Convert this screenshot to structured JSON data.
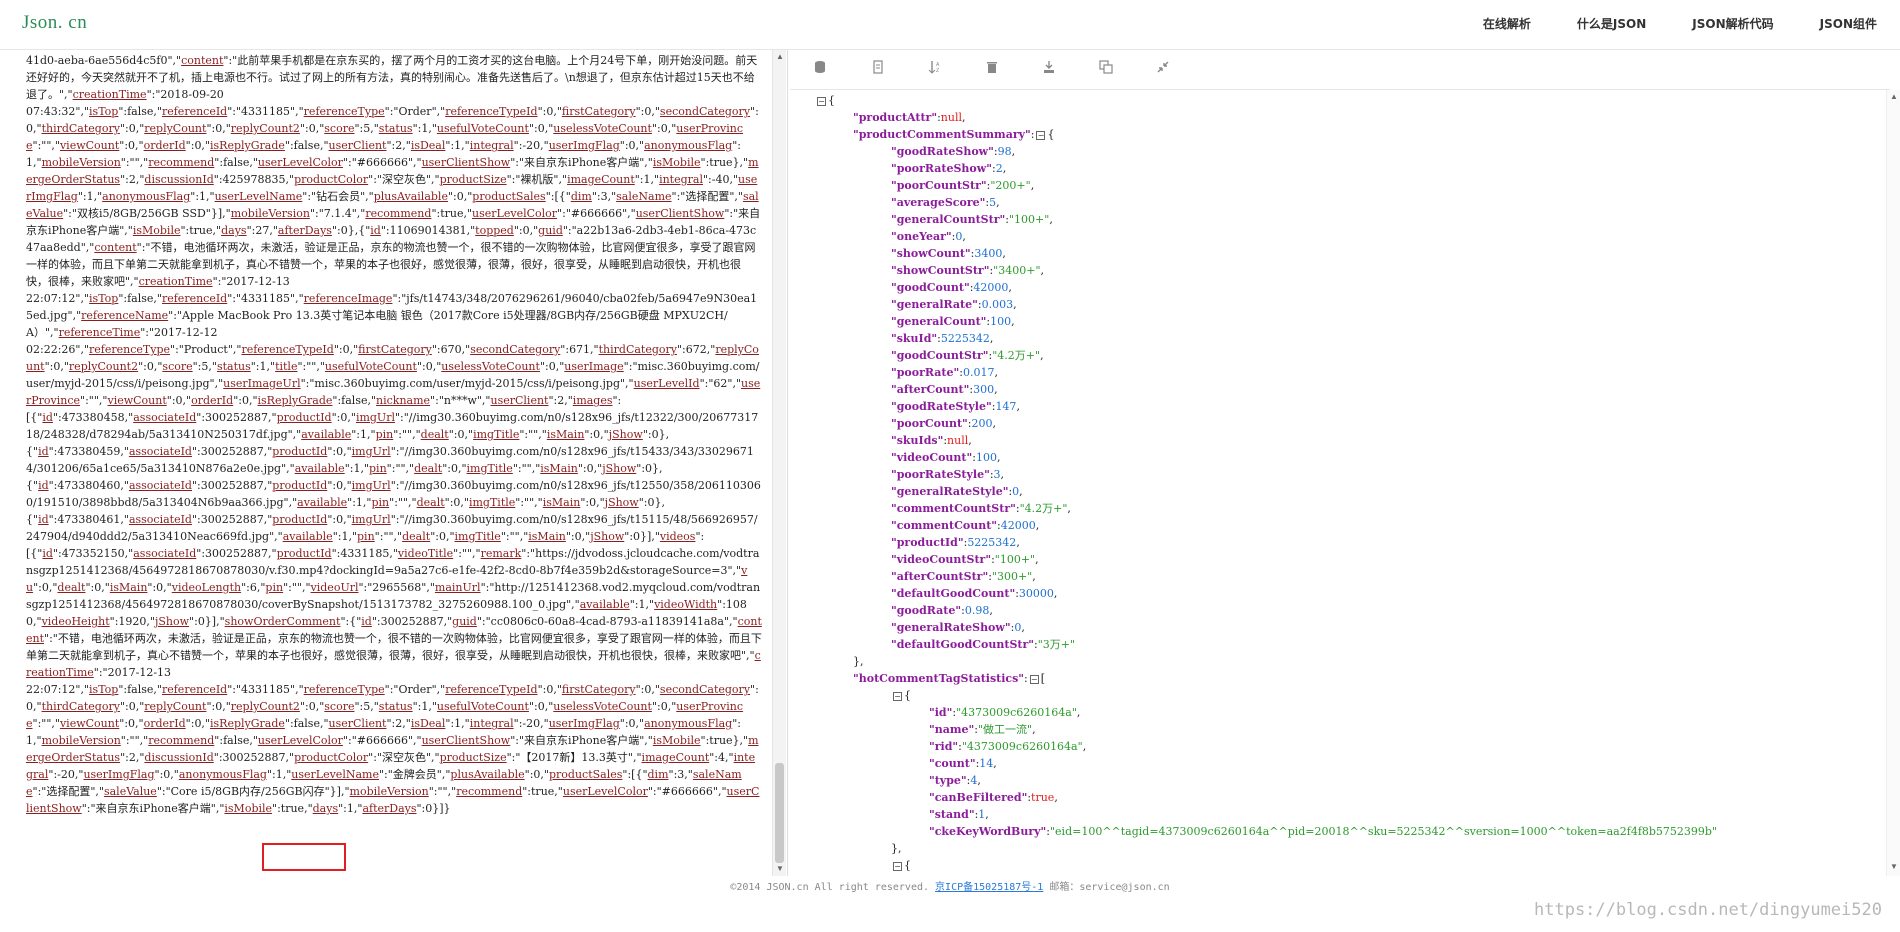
{
  "header": {
    "logo": "Json. cn",
    "nav": [
      "在线解析",
      "什么是JSON",
      "JSON解析代码",
      "JSON组件"
    ]
  },
  "left_text": [
    "41d0-aeba-6ae556d4c5f0\",\"content\":\"此前苹果手机都是在京东买的，摆了两个月的工资才买的这台电脑。上个月24号下单，刚开始没问题。前天还好好的，今天突然就开不了机，插上电源也不行。试过了网上的所有方法，真的特别闹心。准备先送售后了。\\n想退了，但京东估计超过15天也不给退了。\",\"creationTime\":\"2018-09-20",
    "07:43:32\",\"isTop\":false,\"referenceId\":\"4331185\",\"referenceType\":\"Order\",\"referenceTypeId\":0,\"firstCategory\":0,\"secondCategory\":0,\"thirdCategory\":0,\"replyCount\":0,\"replyCount2\":0,\"score\":5,\"status\":1,\"usefulVoteCount\":0,\"uselessVoteCount\":0,\"userProvince\":\"\",\"viewCount\":0,\"orderId\":0,\"isReplyGrade\":false,\"userClient\":2,\"isDeal\":1,\"integral\":-20,\"userImgFlag\":0,\"anonymousFlag\":1,\"mobileVersion\":\"\",\"recommend\":false,\"userLevelColor\":\"#666666\",\"userClientShow\":\"来自京东iPhone客户端\",\"isMobile\":true},\"mergeOrderStatus\":2,\"discussionId\":425978835,\"productColor\":\"深空灰色\",\"productSize\":\"裸机版\",\"imageCount\":1,\"integral\":-40,\"userImgFlag\":1,\"anonymousFlag\":1,\"userLevelName\":\"钻石会员\",\"plusAvailable\":0,\"productSales\":[{\"dim\":3,\"saleName\":\"选择配置\",\"saleValue\":\"双核i5/8GB/256GB SSD\"}],\"mobileVersion\":\"7.1.4\",\"recommend\":true,\"userLevelColor\":\"#666666\",\"userClientShow\":\"来自京东iPhone客户端\",\"isMobile\":true,\"days\":27,\"afterDays\":0},{\"id\":11069014381,\"topped\":0,\"guid\":\"a22b13a6-2db3-4eb1-86ca-473c47aa8edd\",\"content\":\"不错，电池循环两次，未激活，验证是正品，京东的物流也赞一个，很不错的一次购物体验，比官网便宜很多，享受了跟官网一样的体验，而且下单第二天就能拿到机子，真心不错赞一个，苹果的本子也很好，感觉很薄，很薄，很好，很享受，从睡眠到启动很快，开机也很快，很棒，来败家吧\",\"creationTime\":\"2017-12-13",
    "22:07:12\",\"isTop\":false,\"referenceId\":\"4331185\",\"referenceImage\":\"jfs/t14743/348/2076296261/96040/cba02feb/5a6947e9N30ea15ed.jpg\",\"referenceName\":\"Apple MacBook Pro 13.3英寸笔记本电脑 银色（2017款Core i5处理器/8GB内存/256GB硬盘 MPXU2CH/A）\",\"referenceTime\":\"2017-12-12",
    "02:22:26\",\"referenceType\":\"Product\",\"referenceTypeId\":0,\"firstCategory\":670,\"secondCategory\":671,\"thirdCategory\":672,\"replyCount\":0,\"replyCount2\":0,\"score\":5,\"status\":1,\"title\":\"\",\"usefulVoteCount\":0,\"uselessVoteCount\":0,\"userImage\":\"misc.360buyimg.com/user/myjd-2015/css/i/peisong.jpg\",\"userImageUrl\":\"misc.360buyimg.com/user/myjd-2015/css/i/peisong.jpg\",\"userLevelId\":\"62\",\"userProvince\":\"\",\"viewCount\":0,\"orderId\":0,\"isReplyGrade\":false,\"nickname\":\"n***w\",\"userClient\":2,\"images\":",
    "[{\"id\":473380458,\"associateId\":300252887,\"productId\":0,\"imgUrl\":\"//img30.360buyimg.com/n0/s128x96_jfs/t12322/300/2067731718/248328/d78294ab/5a313410N250317df.jpg\",\"available\":1,\"pin\":\"\",\"dealt\":0,\"imgTitle\":\"\",\"isMain\":0,\"jShow\":0},",
    "{\"id\":473380459,\"associateId\":300252887,\"productId\":0,\"imgUrl\":\"//img30.360buyimg.com/n0/s128x96_jfs/t15433/343/330296714/301206/65a1ce65/5a313410N876a2e0e.jpg\",\"available\":1,\"pin\":\"\",\"dealt\":0,\"imgTitle\":\"\",\"isMain\":0,\"jShow\":0},",
    "{\"id\":473380460,\"associateId\":300252887,\"productId\":0,\"imgUrl\":\"//img30.360buyimg.com/n0/s128x96_jfs/t12550/358/2061103060/191510/3898bbd8/5a313404N6b9aa366.jpg\",\"available\":1,\"pin\":\"\",\"dealt\":0,\"imgTitle\":\"\",\"isMain\":0,\"jShow\":0},",
    "{\"id\":473380461,\"associateId\":300252887,\"productId\":0,\"imgUrl\":\"//img30.360buyimg.com/n0/s128x96_jfs/t15115/48/566926957/247904/d940ddd2/5a313410Neac669fd.jpg\",\"available\":1,\"pin\":\"\",\"dealt\":0,\"imgTitle\":\"\",\"isMain\":0,\"jShow\":0}],\"videos\":",
    "[{\"id\":473352150,\"associateId\":300252887,\"productId\":4331185,\"videoTitle\":\"\",\"remark\":\"https://jdvodoss.jcloudcache.com/vodtransgzp1251412368/4564972818670878030/v.f30.mp4?dockingId=9a5a27c6-e1fe-42f2-8cd0-8b7f4e359b2d&storageSource=3\",\"vu\":0,\"dealt\":0,\"isMain\":0,\"videoLength\":6,\"pin\":\"\",\"videoUrl\":\"2965568\",\"mainUrl\":\"http://1251412368.vod2.myqcloud.com/vodtransgzp1251412368/4564972818670878030/coverBySnapshot/1513173782_3275260988.100_0.jpg\",\"available\":1,\"videoWidth\":1080,\"videoHeight\":1920,\"jShow\":0}],\"showOrderComment\":{\"id\":300252887,\"guid\":\"cc0806c0-60a8-4cad-8793-a11839141a8a\",\"content\":\"不错，电池循环两次，未激活，验证是正品，京东的物流也赞一个，很不错的一次购物体验，比官网便宜很多，享受了跟官网一样的体验，而且下单第二天就能拿到机子，真心不错赞一个，苹果的本子也很好，感觉很薄，很薄，很好，很享受，从睡眠到启动很快，开机也很快，很棒，来败家吧\",\"creationTime\":\"2017-12-13",
    "22:07:12\",\"isTop\":false,\"referenceId\":\"4331185\",\"referenceType\":\"Order\",\"referenceTypeId\":0,\"firstCategory\":0,\"secondCategory\":0,\"thirdCategory\":0,\"replyCount\":0,\"replyCount2\":0,\"score\":5,\"status\":1,\"usefulVoteCount\":0,\"uselessVoteCount\":0,\"userProvince\":\"\",\"viewCount\":0,\"orderId\":0,\"isReplyGrade\":false,\"userClient\":2,\"isDeal\":1,\"integral\":-20,\"userImgFlag\":0,\"anonymousFlag\":1,\"mobileVersion\":\"\",\"recommend\":false,\"userLevelColor\":\"#666666\",\"userClientShow\":\"来自京东iPhone客户端\",\"isMobile\":true},\"mergeOrderStatus\":2,\"discussionId\":300252887,\"productColor\":\"深空灰色\",\"productSize\":\"【2017新】13.3英寸\",\"imageCount\":4,\"integral\":-20,\"userImgFlag\":0,\"anonymousFlag\":1,\"userLevelName\":\"金牌会员\",\"plusAvailable\":0,\"productSales\":[{\"dim\":3,\"saleName\":\"选择配置\",\"saleValue\":\"Core i5/8GB内存/256GB闪存\"}],\"mobileVersion\":\"\",\"recommend\":true,\"userLevelColor\":\"#666666\",\"userClientShow\":\"来自京东iPhone客户端\",\"isMobile\":true,\"days\":1,\"afterDays\":0}]}"
  ],
  "toolbar_icons": [
    "database-icon",
    "file-icon",
    "sort-icon",
    "delete-icon",
    "download-icon",
    "copy-icon",
    "compress-icon"
  ],
  "tree": [
    {
      "d": 0,
      "t": "open",
      "text": "{"
    },
    {
      "d": 1,
      "k": "productAttr",
      "v": "null",
      "vt": "nl"
    },
    {
      "d": 1,
      "k": "productCommentSummary",
      "t": "open",
      "text": "{"
    },
    {
      "d": 2,
      "k": "goodRateShow",
      "v": "98",
      "vt": "n"
    },
    {
      "d": 2,
      "k": "poorRateShow",
      "v": "2",
      "vt": "n"
    },
    {
      "d": 2,
      "k": "poorCountStr",
      "v": "\"200+\"",
      "vt": "s"
    },
    {
      "d": 2,
      "k": "averageScore",
      "v": "5",
      "vt": "n"
    },
    {
      "d": 2,
      "k": "generalCountStr",
      "v": "\"100+\"",
      "vt": "s"
    },
    {
      "d": 2,
      "k": "oneYear",
      "v": "0",
      "vt": "n"
    },
    {
      "d": 2,
      "k": "showCount",
      "v": "3400",
      "vt": "n"
    },
    {
      "d": 2,
      "k": "showCountStr",
      "v": "\"3400+\"",
      "vt": "s"
    },
    {
      "d": 2,
      "k": "goodCount",
      "v": "42000",
      "vt": "n"
    },
    {
      "d": 2,
      "k": "generalRate",
      "v": "0.003",
      "vt": "n"
    },
    {
      "d": 2,
      "k": "generalCount",
      "v": "100",
      "vt": "n"
    },
    {
      "d": 2,
      "k": "skuId",
      "v": "5225342",
      "vt": "n"
    },
    {
      "d": 2,
      "k": "goodCountStr",
      "v": "\"4.2万+\"",
      "vt": "s"
    },
    {
      "d": 2,
      "k": "poorRate",
      "v": "0.017",
      "vt": "n"
    },
    {
      "d": 2,
      "k": "afterCount",
      "v": "300",
      "vt": "n"
    },
    {
      "d": 2,
      "k": "goodRateStyle",
      "v": "147",
      "vt": "n"
    },
    {
      "d": 2,
      "k": "poorCount",
      "v": "200",
      "vt": "n"
    },
    {
      "d": 2,
      "k": "skuIds",
      "v": "null",
      "vt": "nl"
    },
    {
      "d": 2,
      "k": "videoCount",
      "v": "100",
      "vt": "n"
    },
    {
      "d": 2,
      "k": "poorRateStyle",
      "v": "3",
      "vt": "n"
    },
    {
      "d": 2,
      "k": "generalRateStyle",
      "v": "0",
      "vt": "n"
    },
    {
      "d": 2,
      "k": "commentCountStr",
      "v": "\"4.2万+\"",
      "vt": "s"
    },
    {
      "d": 2,
      "k": "commentCount",
      "v": "42000",
      "vt": "n"
    },
    {
      "d": 2,
      "k": "productId",
      "v": "5225342",
      "vt": "n"
    },
    {
      "d": 2,
      "k": "videoCountStr",
      "v": "\"100+\"",
      "vt": "s"
    },
    {
      "d": 2,
      "k": "afterCountStr",
      "v": "\"300+\"",
      "vt": "s"
    },
    {
      "d": 2,
      "k": "defaultGoodCount",
      "v": "30000",
      "vt": "n"
    },
    {
      "d": 2,
      "k": "goodRate",
      "v": "0.98",
      "vt": "n"
    },
    {
      "d": 2,
      "k": "generalRateShow",
      "v": "0",
      "vt": "n"
    },
    {
      "d": 2,
      "k": "defaultGoodCountStr",
      "v": "\"3万+\"",
      "vt": "s",
      "last": true
    },
    {
      "d": 1,
      "text": "},"
    },
    {
      "d": 1,
      "k": "hotCommentTagStatistics",
      "t": "open",
      "text": "["
    },
    {
      "d": 2,
      "t": "open",
      "text": "{"
    },
    {
      "d": 3,
      "k": "id",
      "v": "\"4373009c6260164a\"",
      "vt": "s"
    },
    {
      "d": 3,
      "k": "name",
      "v": "\"做工一流\"",
      "vt": "s"
    },
    {
      "d": 3,
      "k": "rid",
      "v": "\"4373009c6260164a\"",
      "vt": "s"
    },
    {
      "d": 3,
      "k": "count",
      "v": "14",
      "vt": "n"
    },
    {
      "d": 3,
      "k": "type",
      "v": "4",
      "vt": "n"
    },
    {
      "d": 3,
      "k": "canBeFiltered",
      "v": "true",
      "vt": "nl"
    },
    {
      "d": 3,
      "k": "stand",
      "v": "1",
      "vt": "n"
    },
    {
      "d": 3,
      "k": "ckeKeyWordBury",
      "v": "\"eid=100^^tagid=4373009c6260164a^^pid=20018^^sku=5225342^^sversion=1000^^token=aa2f4f8b5752399b\"",
      "vt": "s",
      "last": true
    },
    {
      "d": 2,
      "text": "},"
    },
    {
      "d": 2,
      "t": "open",
      "text": "{"
    }
  ],
  "footer": {
    "copyright": "©2014 JSON.cn All right reserved.",
    "icp": "京ICP备15025187号-1",
    "email": "邮箱：service@json.cn"
  },
  "watermark": "https://blog.csdn.net/dingyumei520"
}
